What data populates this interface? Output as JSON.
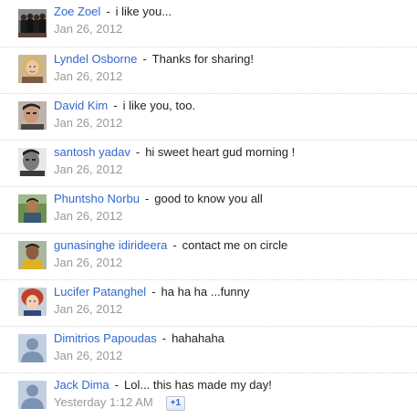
{
  "comments": [
    {
      "author": "Zoe Zoel",
      "text": "i like you...",
      "time": "Jan 26, 2012",
      "avatar_icon": "group-photo-avatar"
    },
    {
      "author": "Lyndel Osborne",
      "text": "Thanks for sharing!",
      "time": "Jan 26, 2012",
      "avatar_icon": "blonde-woman-avatar"
    },
    {
      "author": "David Kim",
      "text": "i like you, too.",
      "time": "Jan 26, 2012",
      "avatar_icon": "man-photo-avatar"
    },
    {
      "author": "santosh yadav",
      "text": "hi sweet heart gud morning !",
      "time": "Jan 26, 2012",
      "avatar_icon": "bw-man-avatar"
    },
    {
      "author": "Phuntsho Norbu",
      "text": "good to know you all",
      "time": "Jan 26, 2012",
      "avatar_icon": "outdoor-man-avatar"
    },
    {
      "author": "gunasinghe idirideera",
      "text": "contact me on circle",
      "time": "Jan 26, 2012",
      "avatar_icon": "yellow-shirt-avatar"
    },
    {
      "author": "Lucifer Patanghel",
      "text": "ha ha ha ...funny",
      "time": "Jan 26, 2012",
      "avatar_icon": "red-hair-avatar"
    },
    {
      "author": "Dimitrios Papoudas",
      "text": "hahahaha",
      "time": "Jan 26, 2012",
      "avatar_icon": "default-silhouette-avatar"
    },
    {
      "author": "Jack Dima",
      "text": "Lol... this has made my day!",
      "time": "Yesterday 1:12 AM",
      "avatar_icon": "default-silhouette-avatar",
      "plus_one_label": "+1"
    }
  ],
  "colors": {
    "author_link": "#3366cc",
    "timestamp": "#999999",
    "separator": "#d6d6d6"
  }
}
